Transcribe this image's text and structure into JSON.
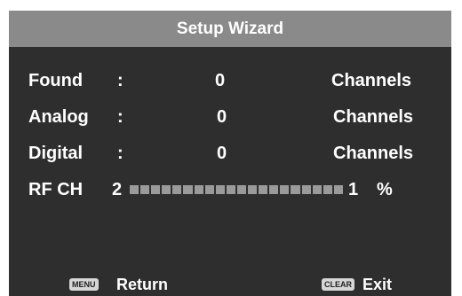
{
  "title": "Setup Wizard",
  "rows": [
    {
      "label": "Found",
      "colon": ":",
      "value": "0",
      "unit": "Channels"
    },
    {
      "label": "Analog",
      "colon": ":",
      "value": "0",
      "unit": "Channels"
    },
    {
      "label": "Digital",
      "colon": ":",
      "value": "0",
      "unit": "Channels"
    }
  ],
  "rf": {
    "label": "RF CH",
    "start": "2",
    "end": "1",
    "percent_sign": "%",
    "progress_percent": 1
  },
  "footer": {
    "menu_key": "MENU",
    "return_label": "Return",
    "clear_key": "CLEAR",
    "exit_label": "Exit"
  },
  "colors": {
    "panel": "#2e2e2e",
    "titlebar": "#8a8a8a",
    "text": "#ffffff"
  }
}
